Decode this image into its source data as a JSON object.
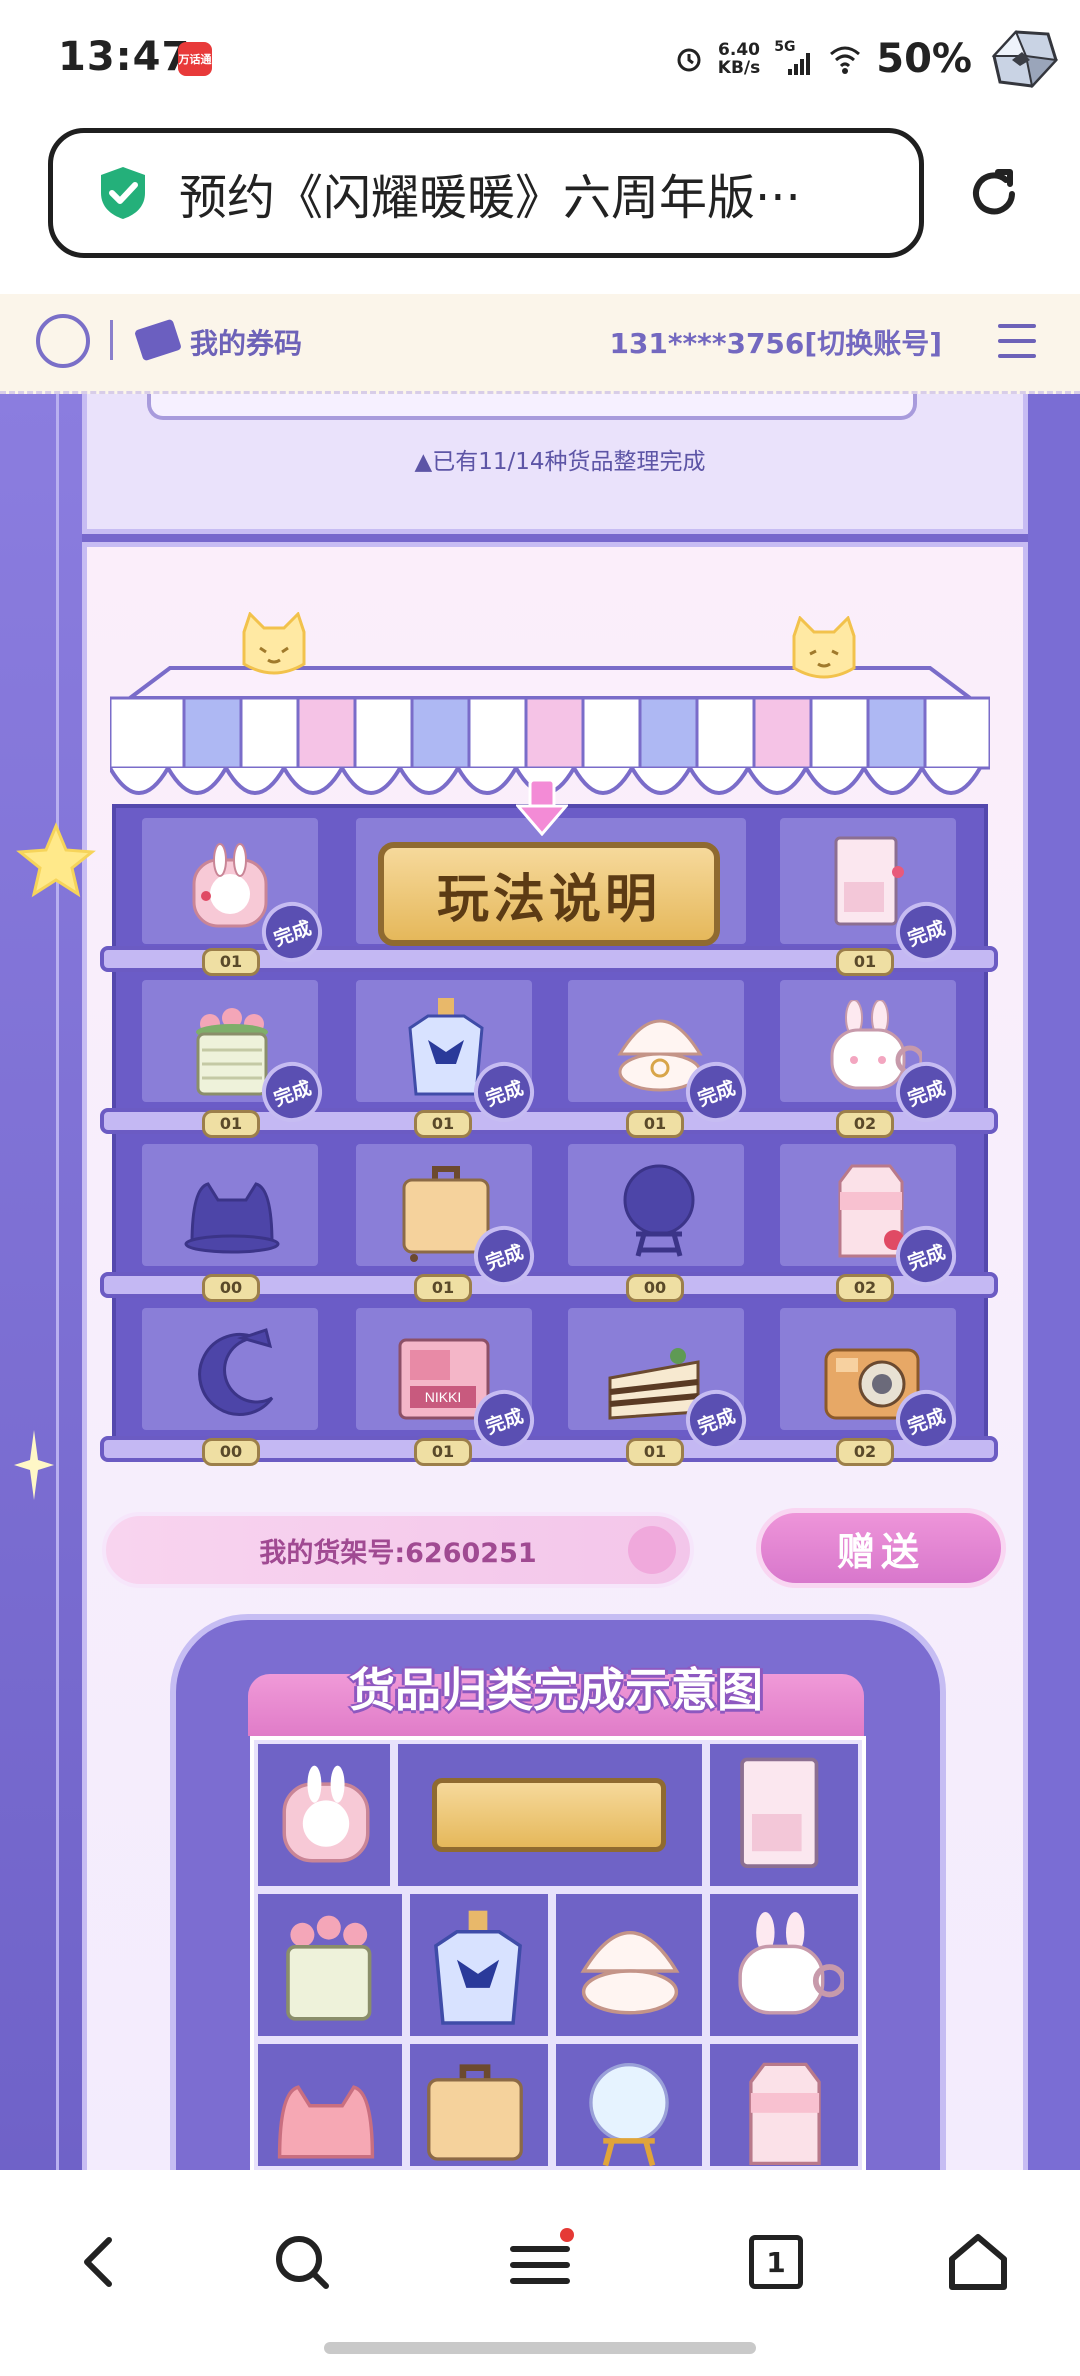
{
  "status_bar": {
    "time": "13:47",
    "app_badge": "万话通",
    "net_speed_value": "6.40",
    "net_speed_unit": "KB/s",
    "network": "5G",
    "battery": "50%",
    "icons": [
      "alarm-icon",
      "signal-icon",
      "wifi-icon"
    ]
  },
  "address_bar": {
    "title": "预约《闪耀暖暖》六周年版···"
  },
  "top_nav": {
    "coupon_label": "我的券码",
    "account_label": "131****3756[切换账号]"
  },
  "previous_panel": {
    "progress_text": "▲已有11/14种货品整理完成"
  },
  "shelf": {
    "rules_label": "玩法说明",
    "done_label": "完成",
    "rows": [
      {
        "items": [
          {
            "name": "bunny-backpack",
            "count": "01",
            "done": true
          },
          {
            "name": "rules-board",
            "count": "",
            "done": false
          },
          {
            "name": "photo-album",
            "count": "01",
            "done": true
          }
        ]
      },
      {
        "items": [
          {
            "name": "flower-basket",
            "count": "01",
            "done": true
          },
          {
            "name": "perfume-bottle",
            "count": "01",
            "done": true
          },
          {
            "name": "shell-ring",
            "count": "01",
            "done": true
          },
          {
            "name": "bunny-mug",
            "count": "02",
            "done": true
          }
        ]
      },
      {
        "items": [
          {
            "name": "cat-hat",
            "count": "00",
            "done": false
          },
          {
            "name": "suitcase",
            "count": "01",
            "done": true
          },
          {
            "name": "crystal-ball",
            "count": "00",
            "done": false
          },
          {
            "name": "milk-carton",
            "count": "02",
            "done": true
          }
        ]
      },
      {
        "items": [
          {
            "name": "moon-pillow",
            "count": "00",
            "done": false
          },
          {
            "name": "nikki-palette",
            "count": "01",
            "done": true
          },
          {
            "name": "cake-slice",
            "count": "01",
            "done": true
          },
          {
            "name": "camera",
            "count": "02",
            "done": true
          }
        ]
      }
    ],
    "shelf_id_label": "我的货架号:6260251",
    "gift_label": "赠送"
  },
  "demo": {
    "title": "货品归类完成示意图"
  },
  "colors": {
    "brand_purple": "#7667cc",
    "panel_border": "#c7bcf3",
    "done_badge": "#5a4fb2",
    "pink_button": "#e07cc8",
    "gold_board": "#e5b85b"
  },
  "bottom_nav": {
    "tab_count": "1",
    "icons": [
      "back-icon",
      "search-icon",
      "menu-icon",
      "tabs-icon",
      "home-icon"
    ]
  }
}
